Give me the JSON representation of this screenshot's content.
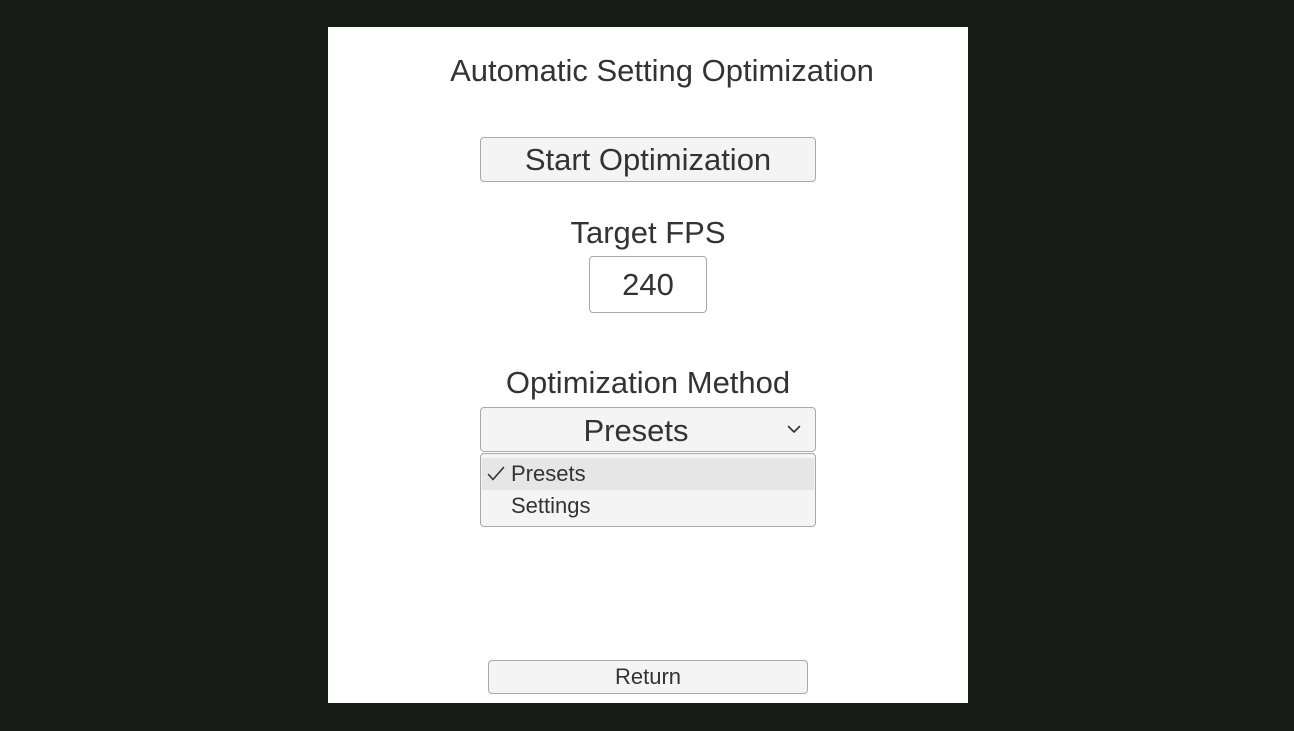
{
  "panel": {
    "title": "Automatic Setting Optimization",
    "start_button_label": "Start Optimization",
    "target_fps": {
      "label": "Target FPS",
      "value": "240"
    },
    "optimization_method": {
      "label": "Optimization Method",
      "selected": "Presets",
      "dropdown_icon": "chevron-down-icon",
      "options": [
        {
          "label": "Presets",
          "selected": true,
          "icon": "check-icon"
        },
        {
          "label": "Settings",
          "selected": false
        }
      ]
    },
    "return_button_label": "Return"
  },
  "colors": {
    "background": "#171c17",
    "panel": "#ffffff",
    "button_fill": "#f4f4f4",
    "border": "#a9a9a9",
    "highlight": "#e6e6e6",
    "text": "#333333"
  }
}
